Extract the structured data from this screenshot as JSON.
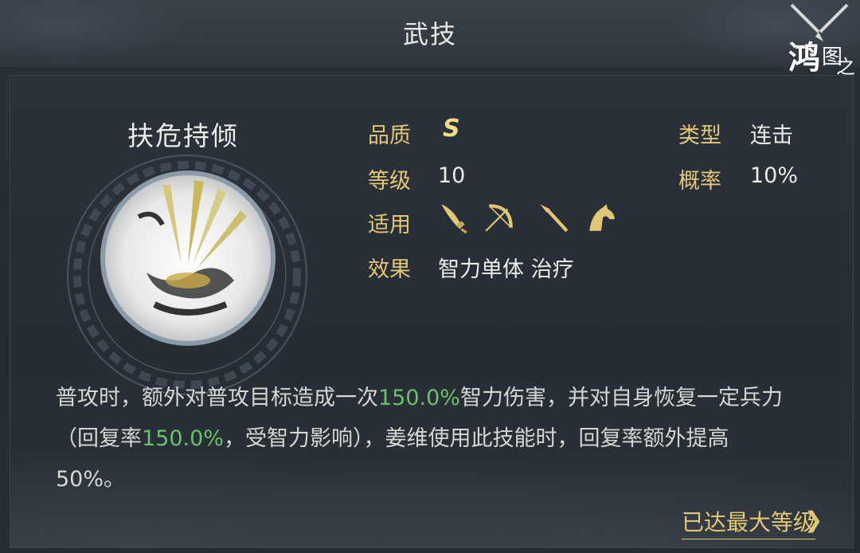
{
  "window": {
    "title": "武技"
  },
  "skill": {
    "name": "扶危持倾",
    "quality_label": "品质",
    "quality_value": "S",
    "level_label": "等级",
    "level_value": "10",
    "apply_label": "适用",
    "apply_icons": [
      "cavalry-blade-icon",
      "bow-icon",
      "spear-icon",
      "horse-icon"
    ],
    "effect_label": "效果",
    "effect_value": "智力单体 治疗",
    "type_label": "类型",
    "type_value": "连击",
    "rate_label": "概率",
    "rate_value": "10%"
  },
  "description": {
    "p1": "普攻时，额外对普攻目标造成一次",
    "h1": "150.0%",
    "p2": "智力伤害，并对自身恢复一定兵力（回复率",
    "h2": "150.0%",
    "p3": "，受智力影响），姜维使用此技能时，回复率额外提高50%。"
  },
  "footer": {
    "max_level_label": "已达最大等级",
    "chevron": "❯"
  },
  "colors": {
    "accent_gold": "#e2c777",
    "highlight_green": "#6cc06a",
    "bg": "#262d34"
  }
}
